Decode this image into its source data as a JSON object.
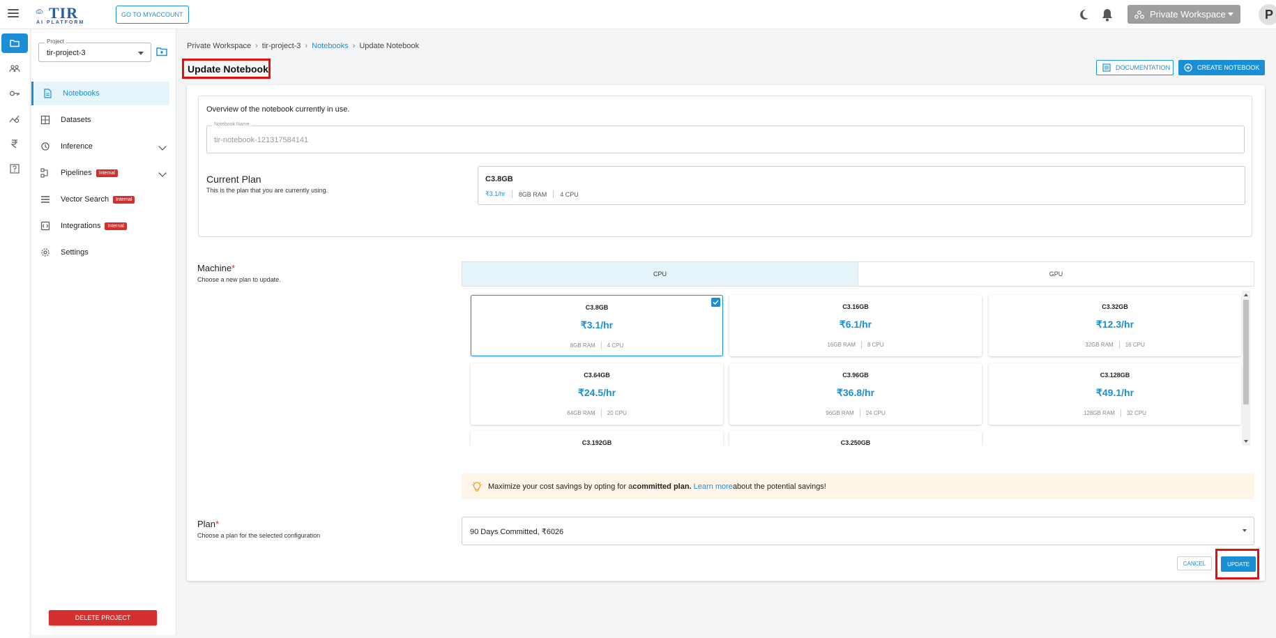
{
  "header": {
    "logo_text": "TIR",
    "logo_sub": "AI PLATFORM",
    "go_to_myaccount": "GO TO MYACCOUNT",
    "workspace": "Private Workspace",
    "avatar_letter": "P"
  },
  "sidebar": {
    "project_label": "Project",
    "project_value": "tir-project-3",
    "items": [
      {
        "label": "Notebooks"
      },
      {
        "label": "Datasets"
      },
      {
        "label": "Inference"
      },
      {
        "label": "Pipelines",
        "badge": "Internal"
      },
      {
        "label": "Vector Search",
        "badge": "Internal"
      },
      {
        "label": "Integrations",
        "badge": "Internal"
      },
      {
        "label": "Settings"
      }
    ],
    "delete_project": "DELETE PROJECT"
  },
  "breadcrumb": {
    "items": [
      "Private Workspace",
      "tir-project-3",
      "Notebooks",
      "Update Notebook"
    ]
  },
  "page": {
    "title": "Update Notebook",
    "documentation": "DOCUMENTATION",
    "create_notebook": "CREATE NOTEBOOK"
  },
  "overview": {
    "text": "Overview of the notebook currently in use.",
    "notebook_name_label": "Notebook Name",
    "notebook_name_value": "tir-notebook-121317584141"
  },
  "current_plan": {
    "title": "Current Plan",
    "subtitle": "This is the plan that you are currently using.",
    "name": "C3.8GB",
    "price": "₹3.1/hr",
    "ram": "8GB RAM",
    "cpu": "4 CPU"
  },
  "machine": {
    "title": "Machine",
    "required": "*",
    "subtitle": "Choose a new plan to update.",
    "tabs": [
      "CPU",
      "GPU"
    ],
    "active_tab": "CPU",
    "plans": [
      {
        "name": "C3.8GB",
        "price": "₹3.1/hr",
        "ram": "8GB RAM",
        "cpu": "4 CPU",
        "selected": true
      },
      {
        "name": "C3.16GB",
        "price": "₹6.1/hr",
        "ram": "16GB RAM",
        "cpu": "8 CPU"
      },
      {
        "name": "C3.32GB",
        "price": "₹12.3/hr",
        "ram": "32GB RAM",
        "cpu": "16 CPU"
      },
      {
        "name": "C3.64GB",
        "price": "₹24.5/hr",
        "ram": "64GB RAM",
        "cpu": "20 CPU"
      },
      {
        "name": "C3.96GB",
        "price": "₹36.8/hr",
        "ram": "96GB RAM",
        "cpu": "24 CPU"
      },
      {
        "name": "C3.128GB",
        "price": "₹49.1/hr",
        "ram": "128GB RAM",
        "cpu": "32 CPU"
      },
      {
        "name": "C3.192GB"
      },
      {
        "name": "C3.250GB"
      }
    ]
  },
  "tip": {
    "part1": "Maximize your cost savings by opting for a ",
    "bold": "committed plan.",
    "link": "Learn more",
    "part2": " about the potential savings!"
  },
  "plan": {
    "title": "Plan",
    "required": "*",
    "subtitle": "Choose a plan for the selected configuration",
    "value": "90 Days Committed, ₹6026"
  },
  "actions": {
    "cancel": "CANCEL",
    "update": "UPDATE"
  },
  "colors": {
    "accent": "#1a8fd6",
    "danger": "#d32f2f",
    "highlight": "#e01010"
  }
}
